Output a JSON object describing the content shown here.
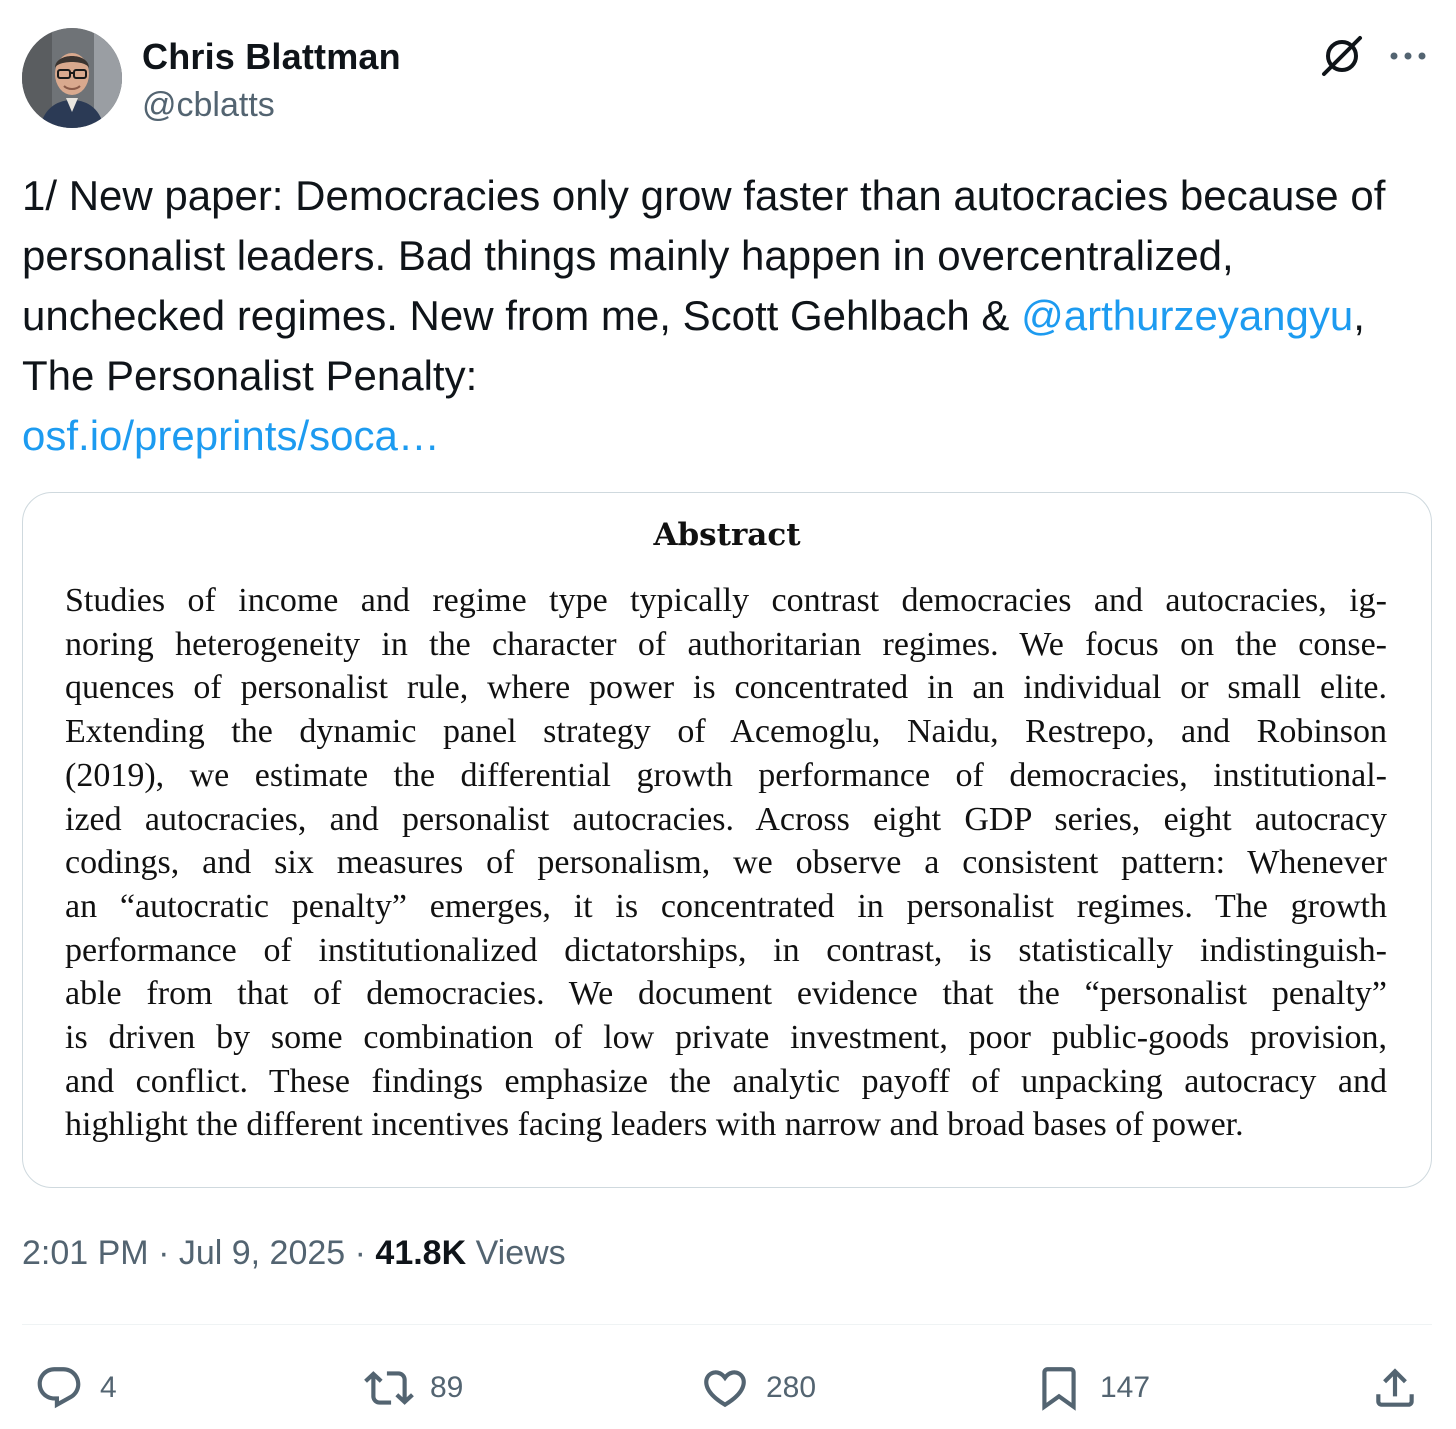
{
  "author": {
    "name": "Chris Blattman",
    "handle": "@cblatts"
  },
  "tweet": {
    "text_part1": "1/ New paper: Democracies only grow faster than autocracies because of personalist leaders. Bad things mainly happen in overcentralized, unchecked regimes. New from me, Scott Gehlbach & ",
    "mention": "@arthurzeyangyu",
    "text_part2": ", The Personalist Penalty:",
    "link": "osf.io/preprints/soca…"
  },
  "abstract": {
    "title": "Abstract",
    "lines": [
      "Studies of income and regime type typically contrast democracies and autocracies, ig-",
      "noring heterogeneity in the character of authoritarian regimes. We focus on the conse-",
      "quences of personalist rule, where power is concentrated in an individual or small elite.",
      "Extending the dynamic panel strategy of Acemoglu, Naidu, Restrepo, and Robinson",
      "(2019), we estimate the differential growth performance of democracies, institutional-",
      "ized autocracies, and personalist autocracies. Across eight GDP series, eight autocracy",
      "codings, and six measures of personalism, we observe a consistent pattern: Whenever",
      "an “autocratic penalty” emerges, it is concentrated in personalist regimes. The growth",
      "performance of institutionalized dictatorships, in contrast, is statistically indistinguish-",
      "able from that of democracies. We document evidence that the “personalist penalty”",
      "is driven by some combination of low private investment, poor public-goods provision,",
      "and conflict. These findings emphasize the analytic payoff of unpacking autocracy and",
      "highlight the different incentives facing leaders with narrow and broad bases of power."
    ]
  },
  "meta": {
    "time": "2:01 PM",
    "separator": " · ",
    "date": "Jul 9, 2025",
    "views_count": "41.8K",
    "views_label": " Views"
  },
  "actions": {
    "replies": "4",
    "reposts": "89",
    "likes": "280",
    "bookmarks": "147"
  },
  "colors": {
    "link": "#1d9bf0",
    "secondary_text": "#536471",
    "primary_text": "#0f1419",
    "border": "#cfd9de"
  },
  "icons": [
    "grok-icon",
    "more-icon",
    "reply-icon",
    "repost-icon",
    "like-icon",
    "bookmark-icon",
    "share-icon"
  ]
}
